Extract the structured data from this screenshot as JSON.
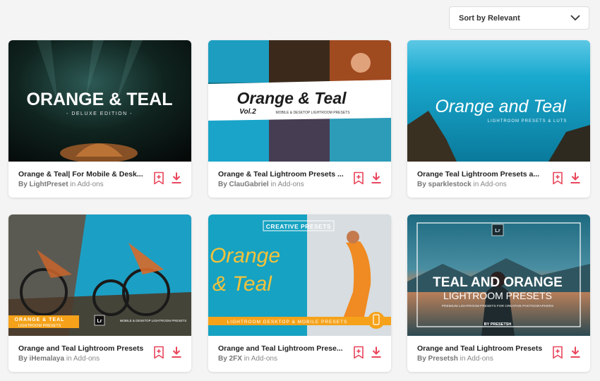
{
  "sort": {
    "label": "Sort by Relevant",
    "icon": "chevron-down-icon"
  },
  "colors": {
    "accent": "#e8465b",
    "teal": "#11a6c6",
    "orange": "#f5a21a"
  },
  "items": [
    {
      "title": "Orange & Teal| For Mobile & Desk...",
      "author": "By LightPreset",
      "category": "in Add-ons",
      "art": {
        "headline": "ORANGE & TEAL",
        "subline": "- DELUXE EDITION -"
      }
    },
    {
      "title": "Orange & Teal Lightroom Presets ...",
      "author": "By ClauGabriel",
      "category": "in Add-ons",
      "art": {
        "headline": "Orange & Teal",
        "tag": "Vol.2",
        "subline": "MOBILE & DESKTOP LIGHTROOM PRESETS"
      }
    },
    {
      "title": "Orange Teal Lightroom Presets a...",
      "author": "By sparklestock",
      "category": "in Add-ons",
      "art": {
        "headline": "Orange and Teal",
        "subline": "LIGHTROOM PRESETS & LUTS"
      }
    },
    {
      "title": "Orange and Teal Lightroom Presets",
      "author": "By iHemalaya",
      "category": "in Add-ons",
      "art": {
        "headline": "ORANGE & TEAL",
        "subline": "LIGHTROOM PRESETS",
        "badge": "Lr",
        "right_text": "MOBILE & DESKTOP LIGHTROOM PRESETS"
      }
    },
    {
      "title": "Orange and Teal Lightroom Prese...",
      "author": "By 2FX",
      "category": "in Add-ons",
      "art": {
        "tag": "CREATIVE PRESETS",
        "headline": "Orange",
        "headline2": "& Teal",
        "subline": "LIGHTROOM DESKTOP & MOBILE PRESETS"
      }
    },
    {
      "title": "Orange and Teal Lightroom Presets",
      "author": "By Presetsh",
      "category": "in Add-ons",
      "art": {
        "badge": "Lr",
        "headline": "TEAL AND ORANGE",
        "headline2": "LIGHTROOM PRESETS",
        "subline": "PREMIUM LIGHTROOM PRESETS FOR CREATIVE PHOTOGRAPHERS",
        "byline": "BY PRESETSH"
      }
    }
  ]
}
